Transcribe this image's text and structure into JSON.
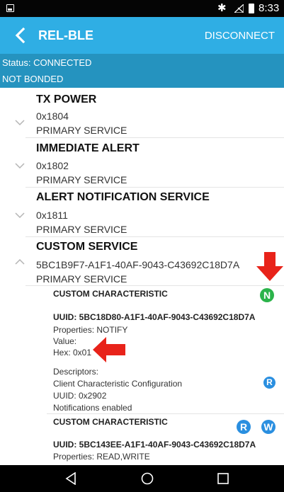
{
  "status_bar": {
    "bluetooth_icon": "bluetooth-icon",
    "signal_icon": "no-signal-icon",
    "battery_icon": "battery-icon",
    "time": "8:33"
  },
  "app_bar": {
    "title": "REL-BLE",
    "action": "DISCONNECT",
    "back_icon": "back-chevron-icon"
  },
  "connection": {
    "status": "Status: CONNECTED",
    "bond": "NOT BONDED"
  },
  "services": [
    {
      "name": "TX POWER",
      "uuid": "0x1804",
      "type": "PRIMARY SERVICE",
      "expanded": false
    },
    {
      "name": "IMMEDIATE ALERT",
      "uuid": "0x1802",
      "type": "PRIMARY SERVICE",
      "expanded": false
    },
    {
      "name": "ALERT NOTIFICATION SERVICE",
      "uuid": "0x1811",
      "type": "PRIMARY SERVICE",
      "expanded": false
    },
    {
      "name": "CUSTOM SERVICE",
      "uuid": "5BC1B9F7-A1F1-40AF-9043-C43692C18D7A",
      "type": "PRIMARY SERVICE",
      "expanded": true
    }
  ],
  "characteristics": [
    {
      "title": "CUSTOM CHARACTERISTIC",
      "uuid": "UUID: 5BC18D80-A1F1-40AF-9043-C43692C18D7A",
      "properties": "Properties: NOTIFY",
      "value_label": "Value:",
      "hex": "Hex: 0x01",
      "descriptors_label": "Descriptors:",
      "descriptor_name": "Client Characteristic Configuration",
      "descriptor_uuid": "UUID: 0x2902",
      "descriptor_value": "Notifications enabled",
      "notify_badge": "N",
      "descriptor_read_badge": "R"
    },
    {
      "title": "CUSTOM CHARACTERISTIC",
      "uuid": "UUID: 5BC143EE-A1F1-40AF-9043-C43692C18D7A",
      "properties": "Properties: READ,WRITE",
      "read_badge": "R",
      "write_badge": "W"
    }
  ],
  "colors": {
    "app_bar": "#2faee4",
    "status_panel": "#2593bf",
    "notify_badge": "#2bb34a",
    "read_write_badge": "#2a8fe0",
    "annotation_arrow": "#e8231a"
  },
  "nav_bar": {
    "back": "nav-back-icon",
    "home": "nav-home-icon",
    "recents": "nav-recents-icon"
  }
}
